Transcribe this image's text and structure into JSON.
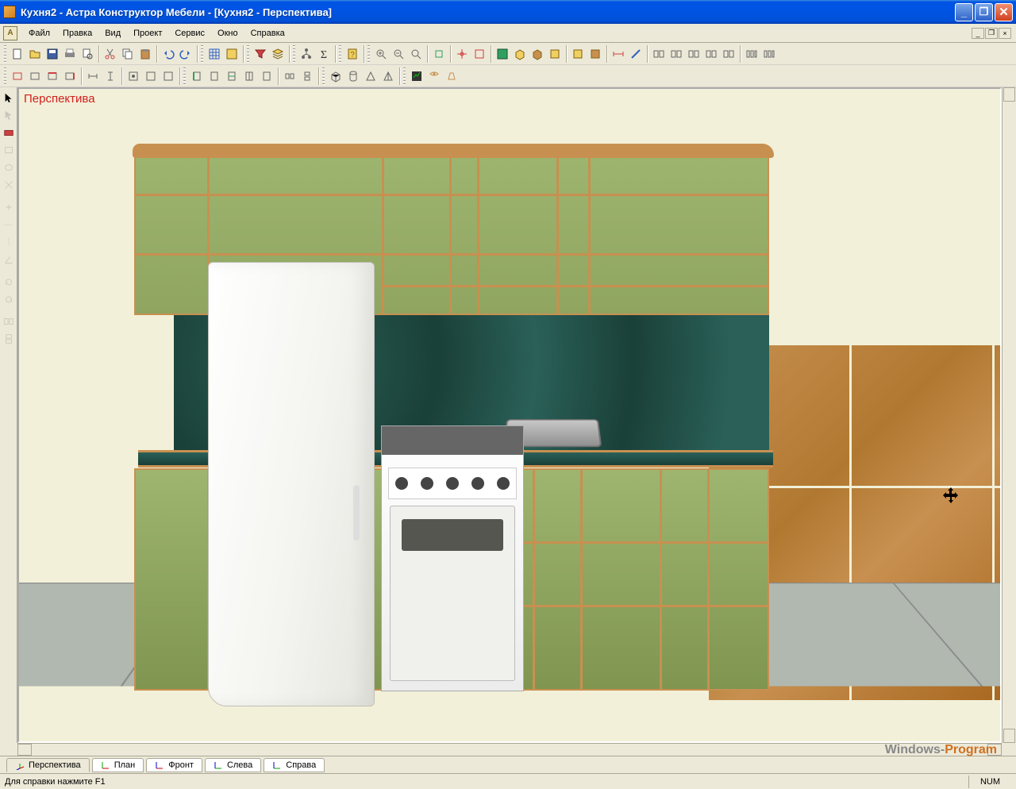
{
  "titlebar": {
    "text": "Кухня2 - Астра Конструктор Мебели - [Кухня2 - Перспектива]"
  },
  "menu": {
    "file": "Файл",
    "edit": "Правка",
    "view": "Вид",
    "project": "Проект",
    "service": "Сервис",
    "window": "Окно",
    "help": "Справка"
  },
  "viewport": {
    "label": "Перспектива"
  },
  "tabs": {
    "perspective": "Перспектива",
    "plan": "План",
    "front": "Фронт",
    "left": "Слева",
    "right": "Справа"
  },
  "status": {
    "hint": "Для справки нажмите F1",
    "num": "NUM"
  },
  "watermark": {
    "part1": "Windows-",
    "part2": "Program"
  }
}
